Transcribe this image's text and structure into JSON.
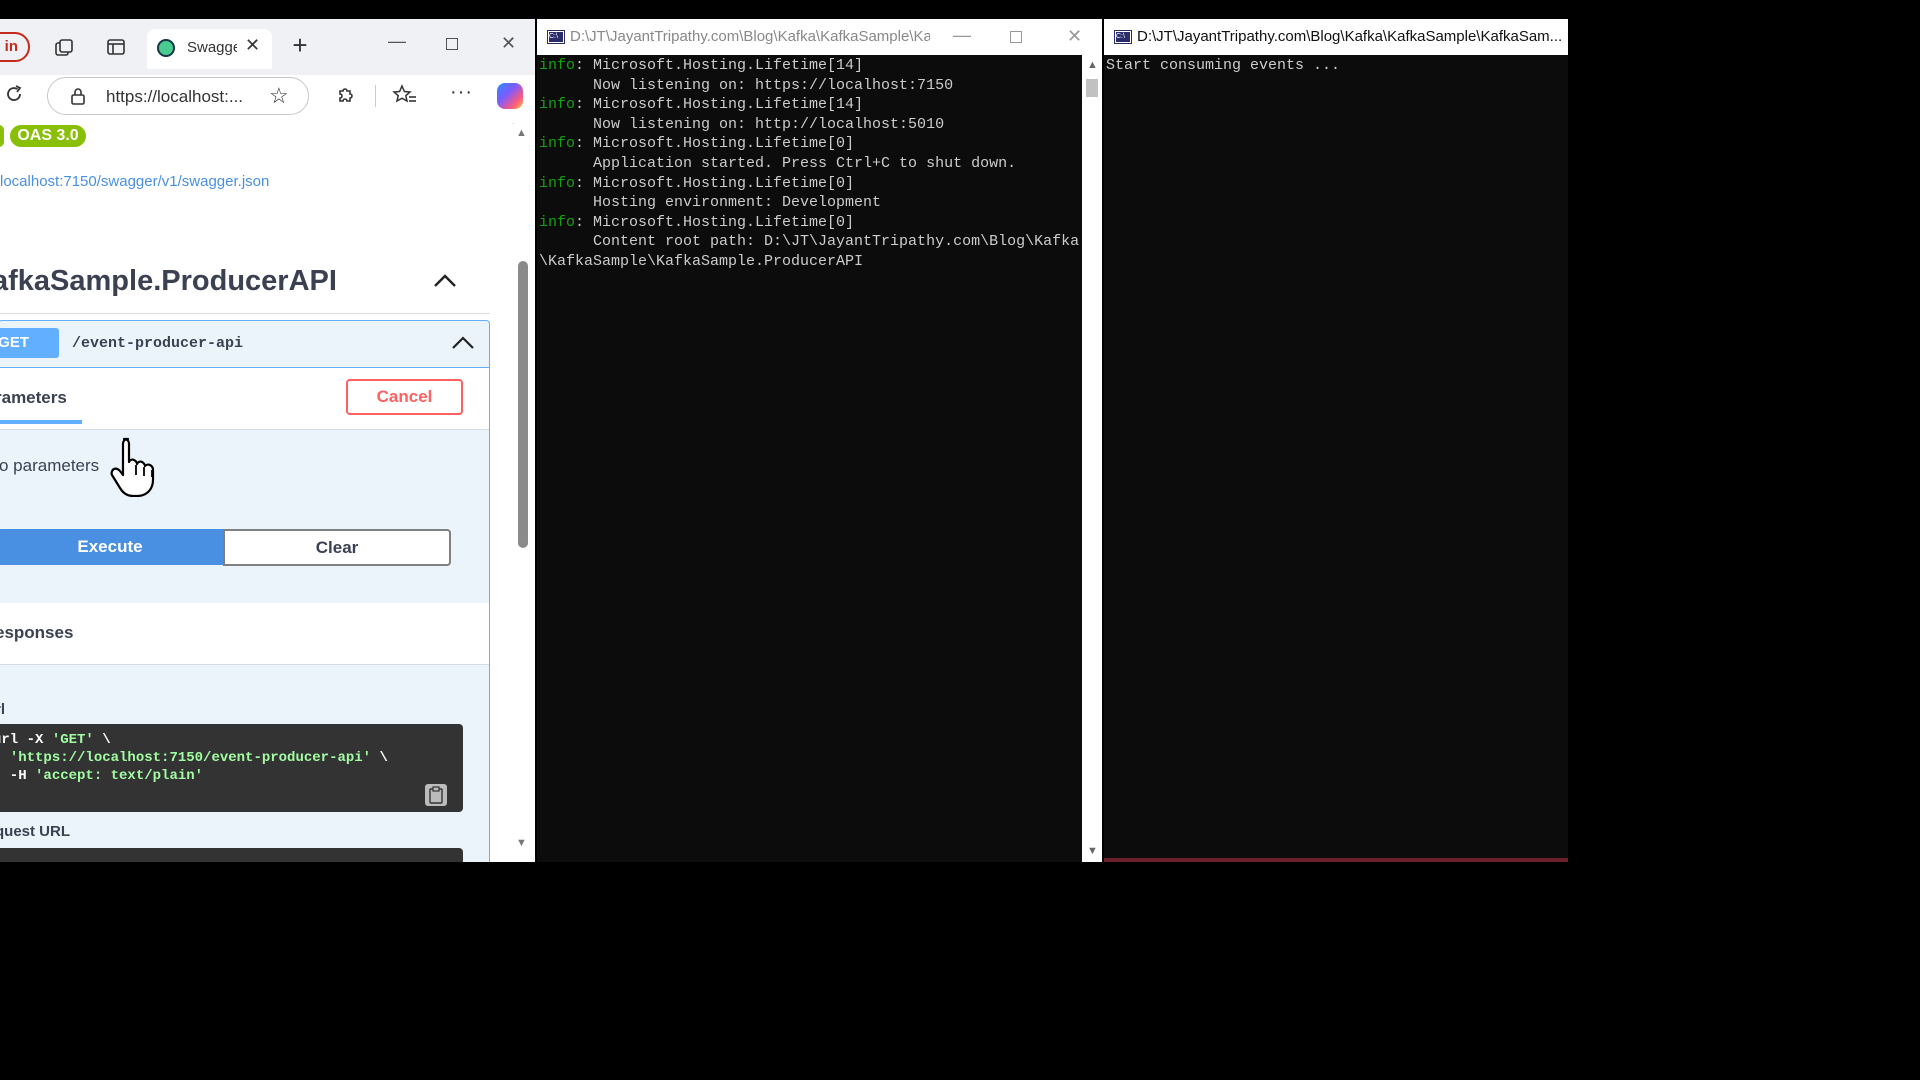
{
  "browser": {
    "signin_label": "n in",
    "active_tab_title": "Swagge",
    "url": "https://localhost:...",
    "swagger": {
      "oas_badge": "OAS 3.0",
      "spec_link": "localhost:7150/swagger/v1/swagger.json",
      "api_title": "afkaSample.ProducerAPI",
      "operation": {
        "method": "GET",
        "path": "/event-producer-api"
      },
      "parameters_tab": "rameters",
      "cancel_label": "Cancel",
      "no_parameters": "o parameters",
      "execute_label": "Execute",
      "clear_label": "Clear",
      "responses_title": "esponses",
      "curl_label": "rl",
      "curl_lines": [
        [
          "url -X ",
          "'GET'",
          " \\"
        ],
        [
          "  ",
          "'https://localhost:7150/event-producer-api'",
          " \\"
        ],
        [
          "  -H ",
          "'accept: text/plain'",
          ""
        ]
      ],
      "request_url_label": "quest URL"
    }
  },
  "producer_console": {
    "title": "D:\\JT\\JayantTripathy.com\\Blog\\Kafka\\KafkaSample\\Ka...",
    "lines": [
      {
        "lvl": "info",
        "text": ": Microsoft.Hosting.Lifetime[14]"
      },
      {
        "lvl": "",
        "text": "      Now listening on: https://localhost:7150"
      },
      {
        "lvl": "info",
        "text": ": Microsoft.Hosting.Lifetime[14]"
      },
      {
        "lvl": "",
        "text": "      Now listening on: http://localhost:5010"
      },
      {
        "lvl": "info",
        "text": ": Microsoft.Hosting.Lifetime[0]"
      },
      {
        "lvl": "",
        "text": "      Application started. Press Ctrl+C to shut down."
      },
      {
        "lvl": "info",
        "text": ": Microsoft.Hosting.Lifetime[0]"
      },
      {
        "lvl": "",
        "text": "      Hosting environment: Development"
      },
      {
        "lvl": "info",
        "text": ": Microsoft.Hosting.Lifetime[0]"
      },
      {
        "lvl": "",
        "text": "      Content root path: D:\\JT\\JayantTripathy.com\\Blog\\Kafka"
      },
      {
        "lvl": "",
        "text": "\\KafkaSample\\KafkaSample.ProducerAPI"
      }
    ]
  },
  "consumer_console": {
    "title": "D:\\JT\\JayantTripathy.com\\Blog\\Kafka\\KafkaSample\\KafkaSam...",
    "lines": [
      {
        "lvl": "",
        "text": "Start consuming events ..."
      }
    ]
  },
  "colors": {
    "get": "#61affe",
    "oas": "#89bf04",
    "cancel": "#ff6060",
    "console_bg": "#0c0c0c",
    "console_info": "#13a10e"
  }
}
